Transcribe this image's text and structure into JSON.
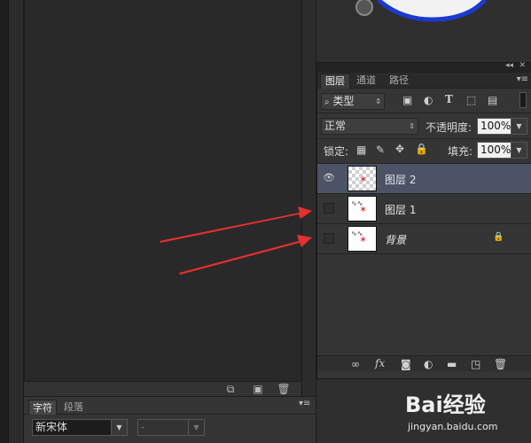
{
  "layers_panel": {
    "tabs": [
      "图层",
      "通道",
      "路径"
    ],
    "filter_label": "类型",
    "blend_mode": "正常",
    "opacity_label": "不透明度:",
    "opacity_value": "100%",
    "lock_label": "锁定:",
    "fill_label": "填充:",
    "fill_value": "100%",
    "layers": [
      {
        "name": "图层 2",
        "visible": true,
        "selected": true
      },
      {
        "name": "图层 1",
        "visible": false,
        "selected": false
      },
      {
        "name": "背景",
        "visible": false,
        "selected": false,
        "locked": true
      }
    ]
  },
  "char_panel": {
    "tabs": [
      "字符",
      "段落"
    ],
    "font_family": "新宋体",
    "font_style": "-"
  },
  "watermark": {
    "logo": "Bai经验",
    "url": "jingyan.baidu.com"
  },
  "colors": {
    "accent_selected": "#4c5366",
    "arrow": "#e53030"
  }
}
